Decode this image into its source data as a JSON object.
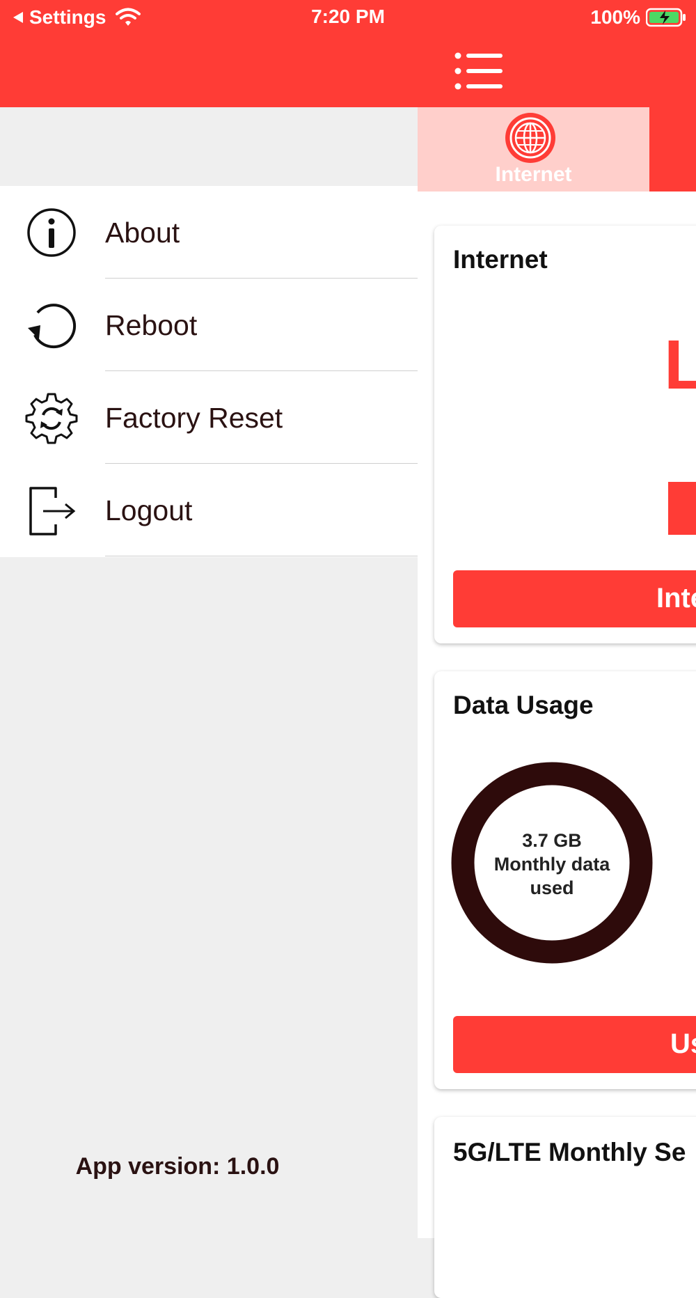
{
  "status_bar": {
    "back_label": "Settings",
    "time": "7:20 PM",
    "battery": "100%"
  },
  "header": {
    "menu_icon": "list-icon"
  },
  "tabs": [
    {
      "label": "Internet",
      "icon": "globe-icon"
    }
  ],
  "drawer": {
    "items": [
      {
        "label": "About",
        "icon": "info-icon"
      },
      {
        "label": "Reboot",
        "icon": "reboot-icon"
      },
      {
        "label": "Factory Reset",
        "icon": "gear-refresh-icon"
      },
      {
        "label": "Logout",
        "icon": "logout-icon"
      }
    ],
    "app_version": "App version: 1.0.0"
  },
  "cards": {
    "internet": {
      "title": "Internet",
      "partial_status": "L",
      "button_partial": "Inte"
    },
    "data_usage": {
      "title": "Data Usage",
      "donut_value": "3.7 GB",
      "donut_line2": "Monthly data",
      "donut_line3": "used",
      "button_partial": "Us"
    },
    "monthly": {
      "title": "5G/LTE Monthly Se"
    }
  },
  "colors": {
    "accent": "#ff3c36",
    "tab_highlight": "#ffcfcb",
    "donut_ring": "#2e0b0b",
    "drawer_bg": "#efefef",
    "text_dark": "#2a1212"
  }
}
